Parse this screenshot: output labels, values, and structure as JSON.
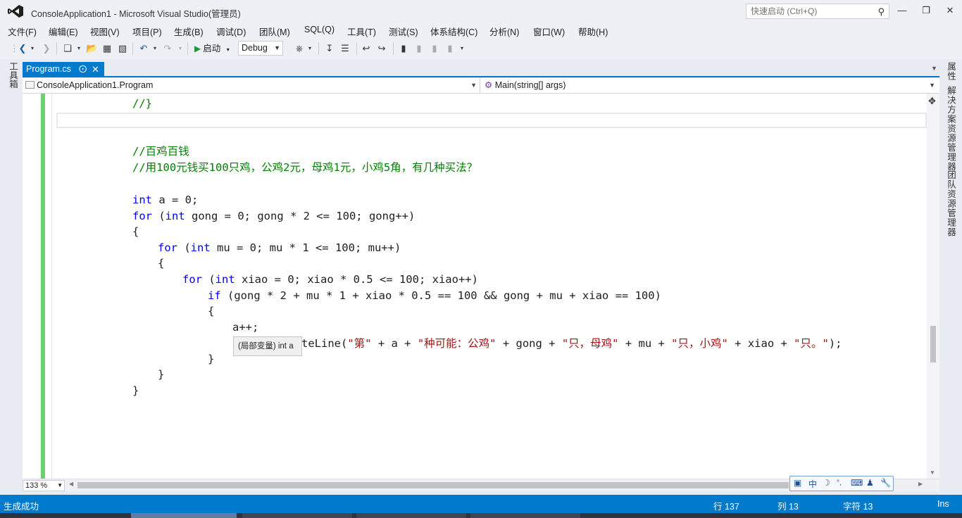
{
  "window": {
    "title": "ConsoleApplication1 - Microsoft Visual Studio(管理员)",
    "quick_launch_placeholder": "快速启动 (Ctrl+Q)"
  },
  "menu": [
    "文件(F)",
    "编辑(E)",
    "视图(V)",
    "项目(P)",
    "生成(B)",
    "调试(D)",
    "团队(M)",
    "SQL(Q)",
    "工具(T)",
    "测试(S)",
    "体系结构(C)",
    "分析(N)",
    "窗口(W)",
    "帮助(H)"
  ],
  "toolbar": {
    "start_label": "启动",
    "config": "Debug"
  },
  "side_tabs": {
    "toolbox": "工具箱",
    "properties": "属性",
    "solution_explorer": "解决方案资源管理器",
    "team_explorer": "团队资源管理器"
  },
  "doc_tab": {
    "label": "Program.cs"
  },
  "navbar": {
    "class": "ConsoleApplication1.Program",
    "member": "Main(string[] args)"
  },
  "code": {
    "l1": "//}",
    "l2": "//百鸡百钱",
    "l3": "//用100元钱买100只鸡，公鸡2元，母鸡1元，小鸡5角，有几种买法？",
    "kw_int": "int",
    "kw_for": "for",
    "kw_if": "if",
    "a_decl": " a = 0;",
    "for1_a": " (",
    "for1_b": " gong = 0; gong * 2 <= 100; gong++)",
    "brace_open": "{",
    "brace_close": "}",
    "for2_b": " mu = 0; mu * 1 <= 100; mu++)",
    "for3_b": " xiao = 0; xiao * 0.5 <= 100; xiao++)",
    "if_cond": " (gong * 2 + mu * 1 + xiao * 0.5 == 100 && gong + mu + xiao == 100)",
    "inc": "a++;",
    "wl_pre": "teLine(",
    "s1": "\"第\"",
    "p1": " + a + ",
    "s2": "\"种可能：公鸡\"",
    "p2": " + gong + ",
    "s3": "\"只，母鸡\"",
    "p3": " + mu + ",
    "s4": "\"只，小鸡\"",
    "p4": " + xiao + ",
    "s5": "\"只。\"",
    "wl_end": ");"
  },
  "tooltip": "(局部变量) int a",
  "zoom": "133 %",
  "status": {
    "message": "生成成功",
    "row": "行 137",
    "col": "列 13",
    "char": "字符 13",
    "mode": "Ins"
  },
  "colors": {
    "accent": "#007acc",
    "keyword": "#0000ff",
    "comment": "#008000",
    "string": "#a31515",
    "change_margin": "#6fcf6a"
  }
}
